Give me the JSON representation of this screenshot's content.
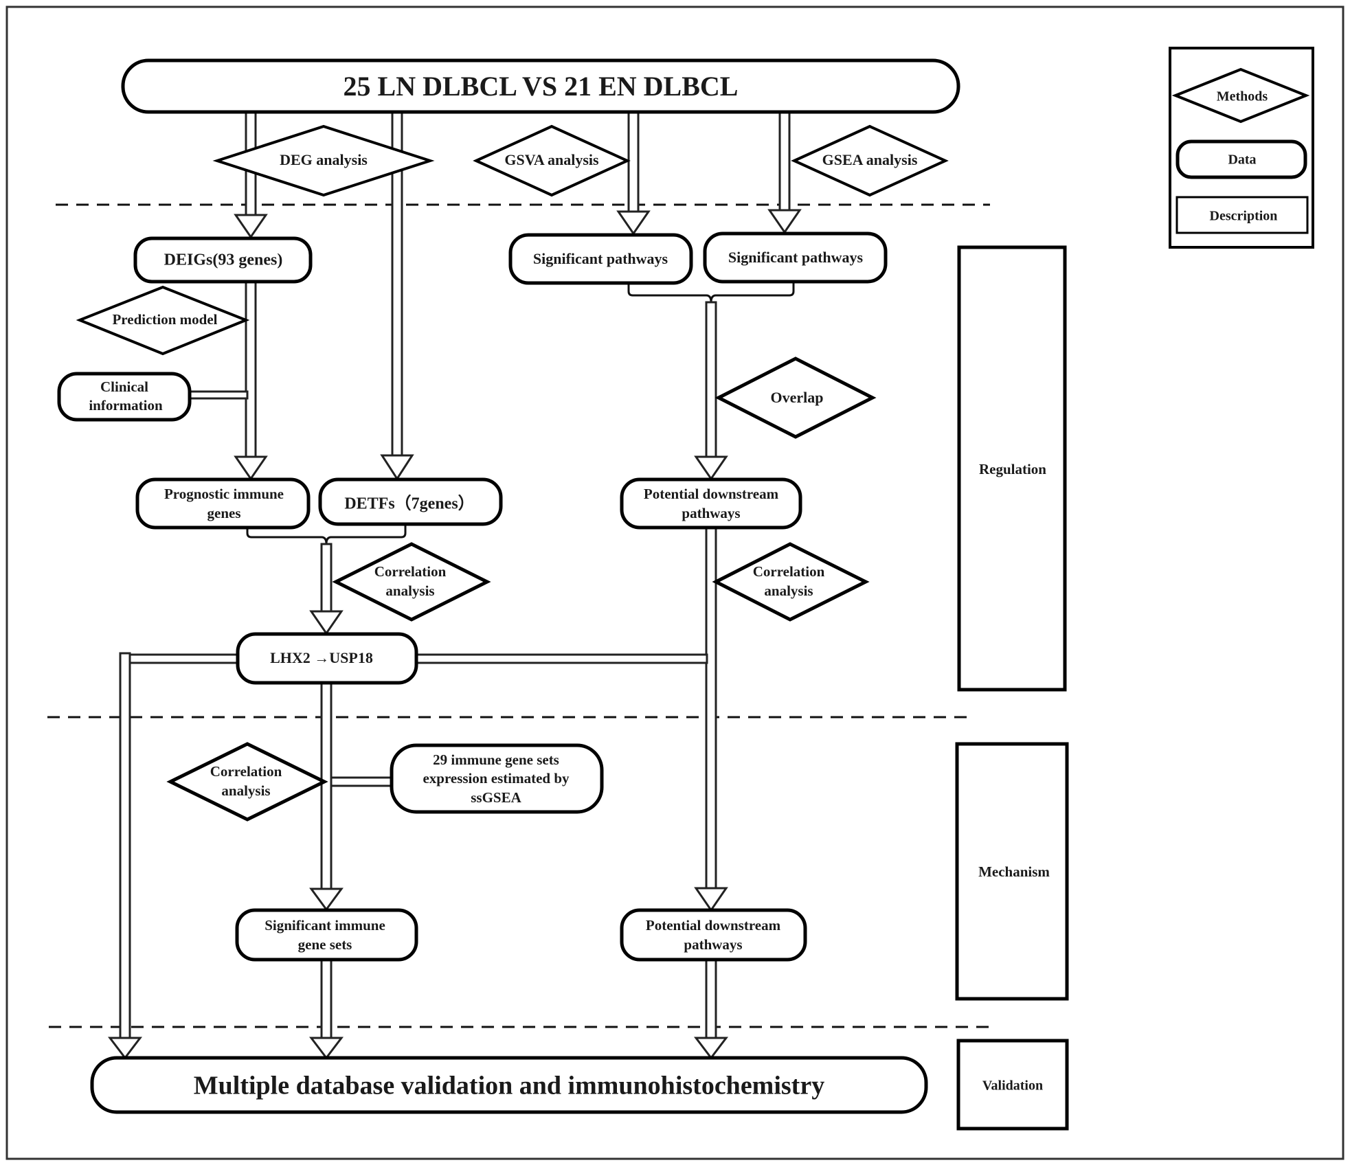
{
  "title_box": "25 LN DLBCL VS 21 EN DLBCL",
  "legend": {
    "methods": "Methods",
    "data": "Data",
    "description": "Description"
  },
  "methods": {
    "deg": "DEG analysis",
    "gsva": "GSVA analysis",
    "gsea": "GSEA analysis",
    "prediction": "Prediction model",
    "overlap": "Overlap",
    "correlation_left_1": "Correlation",
    "correlation_left_2": "analysis",
    "correlation_right_1": "Correlation",
    "correlation_right_2": "analysis",
    "correlation_lower_1": "Correlation",
    "correlation_lower_2": "analysis"
  },
  "data_nodes": {
    "deigs": "DEIGs(93 genes)",
    "sig_pathways_gsva": "Significant pathways",
    "sig_pathways_gsea": "Significant pathways",
    "clinical_1": "Clinical",
    "clinical_2": "information",
    "prognostic_1": "Prognostic immune",
    "prognostic_2": "genes",
    "detfs": "DETFs（7genes）",
    "downstream_1_a": "Potential downstream",
    "downstream_1_b": "pathways",
    "lhx2": "LHX2 →USP18",
    "immune29_a": "29 immune gene sets",
    "immune29_b": "expression estimated by",
    "immune29_c": "ssGSEA",
    "sig_immune_a": "Significant immune",
    "sig_immune_b": "gene sets",
    "downstream_2_a": "Potential downstream",
    "downstream_2_b": "pathways",
    "final": "Multiple database validation and immunohistochemistry"
  },
  "stages": {
    "regulation": "Regulation",
    "mechanism": "Mechanism",
    "validation": "Validation"
  }
}
